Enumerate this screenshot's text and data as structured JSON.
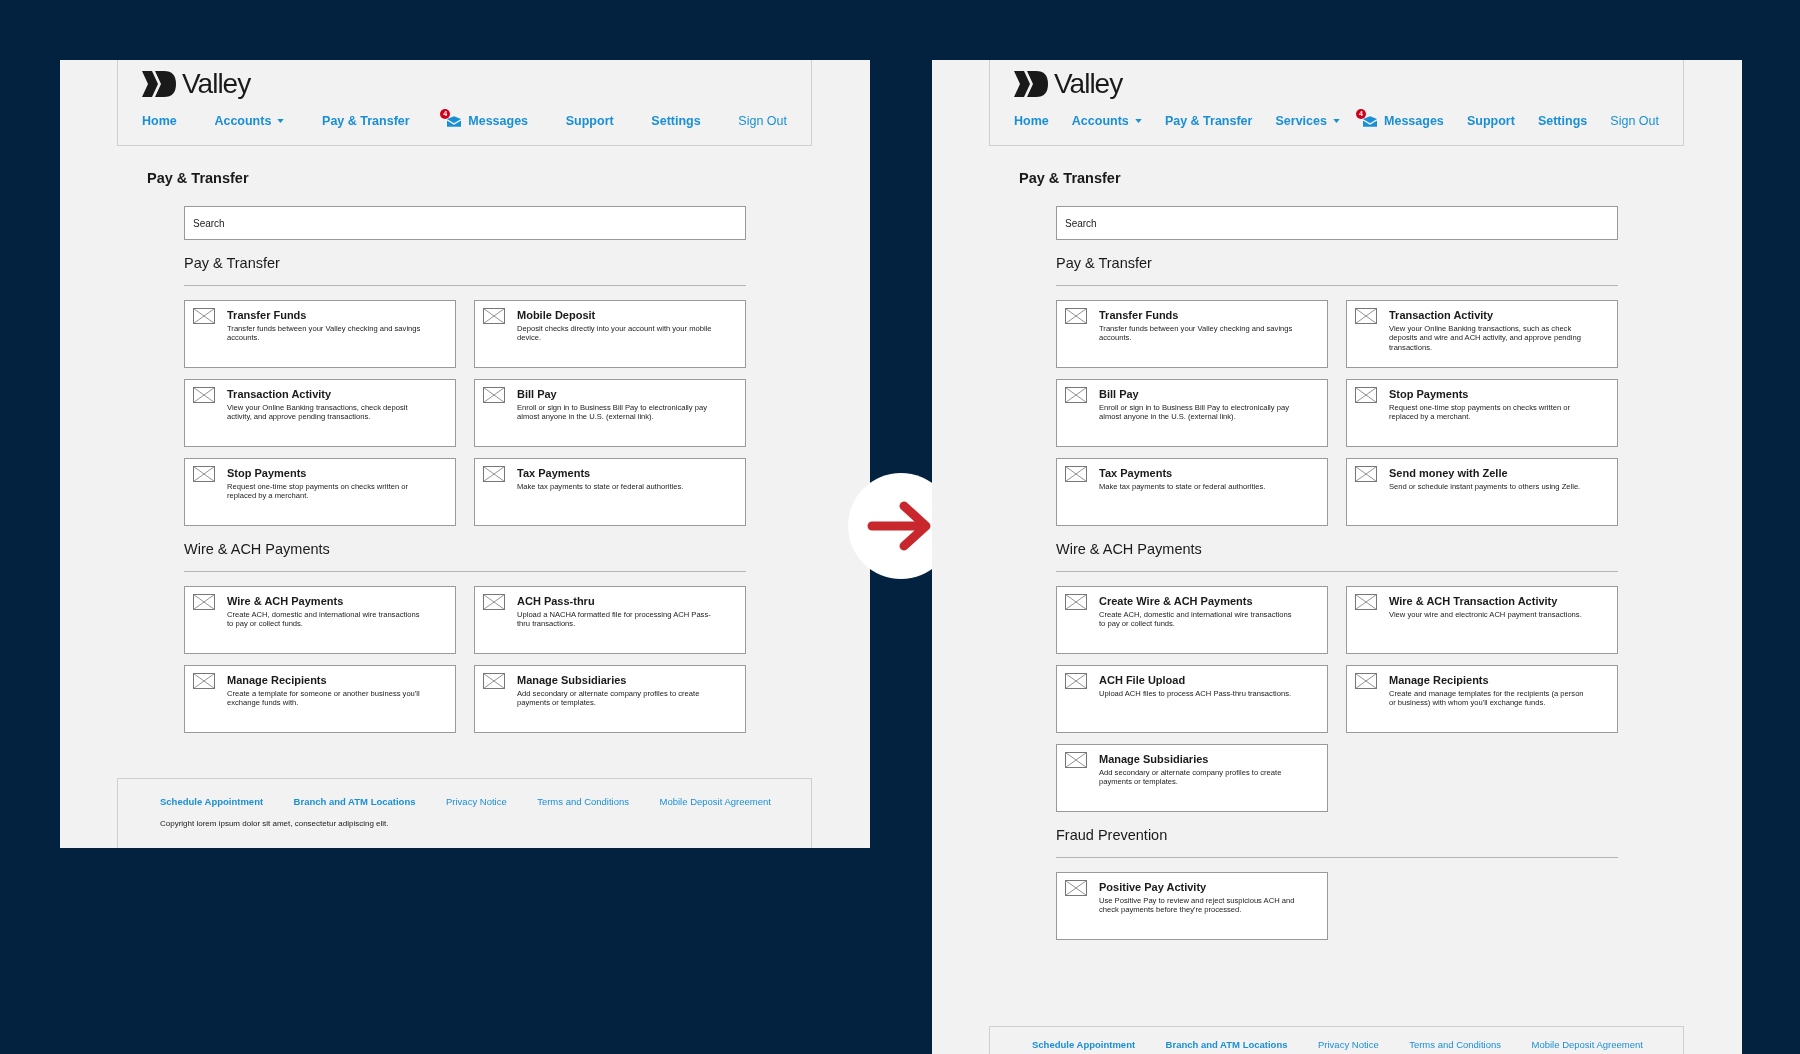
{
  "screens": [
    {
      "header": {
        "logo": "Valley",
        "nav": [
          {
            "label": "Home",
            "kind": "link",
            "emphasis": true
          },
          {
            "label": "Accounts",
            "kind": "dropdown",
            "emphasis": true
          },
          {
            "label": "Pay & Transfer",
            "kind": "link",
            "emphasis": true
          },
          {
            "label": "Messages",
            "kind": "messages",
            "badge": "4",
            "emphasis": true
          },
          {
            "label": "Support",
            "kind": "link",
            "emphasis": true
          },
          {
            "label": "Settings",
            "kind": "link",
            "emphasis": true
          },
          {
            "label": "Sign Out",
            "kind": "link",
            "emphasis": false
          }
        ]
      },
      "page_title": "Pay & Transfer",
      "search": {
        "placeholder": "Search"
      },
      "sections": [
        {
          "heading": "Pay & Transfer",
          "cards": [
            {
              "title": "Transfer Funds",
              "description": "Transfer funds between your Valley checking and savings accounts."
            },
            {
              "title": "Mobile Deposit",
              "description": "Deposit checks directly into your account with your mobile device."
            },
            {
              "title": "Transaction Activity",
              "description": "View your Online Banking transactions, check deposit activity, and approve pending transactions."
            },
            {
              "title": "Bill Pay",
              "description": "Enroll or sign in to Business Bill Pay to electronically pay almost anyone in the U.S. (external link)."
            },
            {
              "title": "Stop Payments",
              "description": "Request one-time stop payments on checks written or replaced by a merchant."
            },
            {
              "title": "Tax Payments",
              "description": "Make tax payments to state or federal authorities."
            }
          ]
        },
        {
          "heading": "Wire & ACH Payments",
          "cards": [
            {
              "title": "Wire & ACH Payments",
              "description": "Create ACH, domestic and international wire transactions to pay or collect funds."
            },
            {
              "title": "ACH Pass-thru",
              "description": "Upload a NACHA formatted file for processing ACH Pass-thru transactions."
            },
            {
              "title": "Manage Recipients",
              "description": "Create a template for someone or another business you'll exchange funds with."
            },
            {
              "title": "Manage Subsidiaries",
              "description": "Add secondary or alternate company profiles to create payments or templates."
            }
          ]
        }
      ],
      "footer": {
        "links": [
          {
            "label": "Schedule Appointment",
            "emphasis": true
          },
          {
            "label": "Branch and ATM Locations",
            "emphasis": true
          },
          {
            "label": "Privacy Notice",
            "emphasis": false
          },
          {
            "label": "Terms and Conditions",
            "emphasis": false
          },
          {
            "label": "Mobile Deposit Agreement",
            "emphasis": false
          }
        ],
        "copyright": "Copyright lorem ipsum dolor sit amet, consectetur adipiscing elit."
      }
    },
    {
      "header": {
        "logo": "Valley",
        "nav": [
          {
            "label": "Home",
            "kind": "link",
            "emphasis": true
          },
          {
            "label": "Accounts",
            "kind": "dropdown",
            "emphasis": true
          },
          {
            "label": "Pay & Transfer",
            "kind": "link",
            "emphasis": true
          },
          {
            "label": "Services",
            "kind": "dropdown",
            "emphasis": true
          },
          {
            "label": "Messages",
            "kind": "messages",
            "badge": "4",
            "emphasis": true
          },
          {
            "label": "Support",
            "kind": "link",
            "emphasis": true
          },
          {
            "label": "Settings",
            "kind": "link",
            "emphasis": true
          },
          {
            "label": "Sign Out",
            "kind": "link",
            "emphasis": false
          }
        ]
      },
      "page_title": "Pay & Transfer",
      "search": {
        "placeholder": "Search"
      },
      "sections": [
        {
          "heading": "Pay & Transfer",
          "cards": [
            {
              "title": "Transfer Funds",
              "description": "Transfer funds between your Valley checking and savings accounts."
            },
            {
              "title": "Transaction Activity",
              "description": "View your Online Banking transactions, such as check deposits and wire and ACH activity, and approve pending transactions."
            },
            {
              "title": "Bill Pay",
              "description": "Enroll or sign in to Business Bill Pay to electronically pay almost anyone in the U.S. (external link)."
            },
            {
              "title": "Stop Payments",
              "description": "Request one-time stop payments on checks written or replaced by a merchant."
            },
            {
              "title": "Tax Payments",
              "description": "Make tax payments to state or federal authorities."
            },
            {
              "title": "Send money with Zelle",
              "description": "Send or schedule instant payments to others using Zelle."
            }
          ]
        },
        {
          "heading": "Wire & ACH Payments",
          "cards": [
            {
              "title": "Create Wire & ACH Payments",
              "description": "Create ACH, domestic and international wire transactions to pay or collect funds."
            },
            {
              "title": "Wire & ACH Transaction Activity",
              "description": "View your wire and electronic ACH payment transactions."
            },
            {
              "title": "ACH File Upload",
              "description": "Upload ACH files to process ACH Pass-thru transactions."
            },
            {
              "title": "Manage Recipients",
              "description": "Create and manage templates for the recipients (a person or business) with whom you'll exchange funds."
            },
            {
              "title": "Manage Subsidiaries",
              "description": "Add secondary or alternate company profiles to create payments or templates."
            }
          ]
        },
        {
          "heading": "Fraud Prevention",
          "cards": [
            {
              "title": "Positive Pay Activity",
              "description": "Use Positive Pay to review and reject suspicious ACH and check payments before they're processed."
            }
          ]
        }
      ],
      "footer": {
        "links": [
          {
            "label": "Schedule Appointment",
            "emphasis": true
          },
          {
            "label": "Branch and ATM Locations",
            "emphasis": true
          },
          {
            "label": "Privacy Notice",
            "emphasis": false
          },
          {
            "label": "Terms and Conditions",
            "emphasis": false
          },
          {
            "label": "Mobile Deposit Agreement",
            "emphasis": false
          }
        ]
      }
    }
  ]
}
